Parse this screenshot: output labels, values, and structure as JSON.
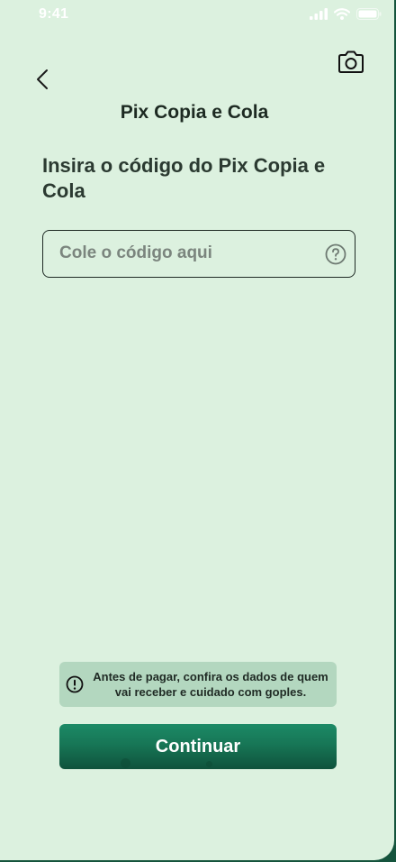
{
  "status_bar": {
    "time": "9:41",
    "icons": [
      "signal-icon",
      "wifi-icon",
      "battery-icon"
    ]
  },
  "header": {
    "back_icon": "chevron-left-icon",
    "camera_icon": "camera-icon",
    "title": "Pix Copia e Cola"
  },
  "main": {
    "heading": "Insira o código do Pix Copia e Cola",
    "code_input": {
      "value": "",
      "placeholder": "Cole o código aqui",
      "help_icon": "question-circle-icon"
    },
    "warning": {
      "icon": "exclamation-circle-icon",
      "text": "Antes de pagar, confira os dados de quem vai receber e cuidado com goples."
    },
    "continue_label": "Continuar"
  },
  "colors": {
    "background": "#dcf1df",
    "primary_button": "#177656",
    "warning_background": "#b3d7bf",
    "text": "#1d2a22"
  }
}
